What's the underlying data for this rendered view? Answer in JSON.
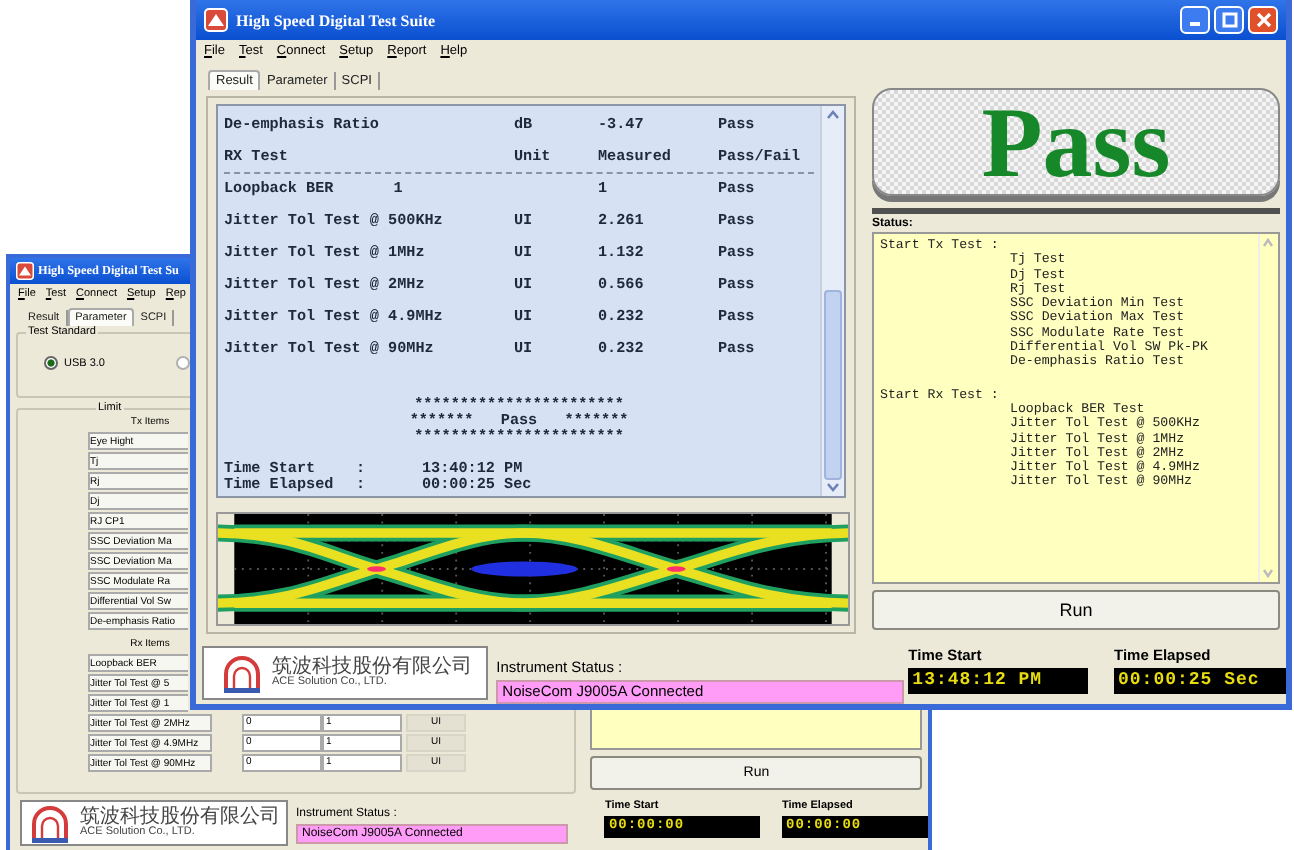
{
  "parameter_window": {
    "title": "High Speed Digital Test Su",
    "menu": [
      "File",
      "Test",
      "Connect",
      "Setup",
      "Rep"
    ],
    "tabs": [
      {
        "label": "Result",
        "selected": false
      },
      {
        "label": "Parameter",
        "selected": true
      },
      {
        "label": "SCPI",
        "selected": false
      }
    ],
    "test_standard": {
      "title": "Test Standard",
      "options": [
        {
          "label": "USB 3.0",
          "selected": true
        },
        {
          "selected": false
        }
      ]
    },
    "limit": {
      "title": "Limit",
      "tx_header": "Tx Items",
      "tx_items": [
        "Eye Hight",
        "Tj",
        "Rj",
        "Dj",
        "RJ CP1",
        "SSC Deviation Ma",
        "SSC Deviation Ma",
        "SSC Modulate Ra",
        "Differential Vol Sw",
        "De-emphasis Ratio"
      ],
      "rx_header": "Rx Items",
      "rx_items": [
        {
          "name": "Loopback BER"
        },
        {
          "name": "Jitter Tol Test @ 5"
        },
        {
          "name": "Jitter Tol Test @ 1"
        },
        {
          "name": "Jitter Tol Test @ 2MHz",
          "min": "0",
          "max": "1",
          "unit": "UI"
        },
        {
          "name": "Jitter Tol Test @ 4.9MHz",
          "min": "0",
          "max": "1",
          "unit": "UI"
        },
        {
          "name": "Jitter Tol Test @ 90MHz",
          "min": "0",
          "max": "1",
          "unit": "UI"
        }
      ]
    },
    "run_button": "Run",
    "company": {
      "name_zh": "筑波科技股份有限公司",
      "name_en": "ACE Solution Co., LTD."
    },
    "instrument_status": {
      "label": "Instrument Status :",
      "value": "NoiseCom J9005A Connected"
    },
    "time_start": {
      "label": "Time Start",
      "value": "00:00:00"
    },
    "time_elapsed": {
      "label": "Time Elapsed",
      "value": "00:00:00"
    }
  },
  "result_window": {
    "title": "High Speed Digital Test Suite",
    "menu": [
      "File",
      "Test",
      "Connect",
      "Setup",
      "Report",
      "Help"
    ],
    "tabs": [
      {
        "label": "Result",
        "selected": true
      },
      {
        "label": "Parameter",
        "selected": false
      },
      {
        "label": "SCPI",
        "selected": false
      }
    ],
    "results": {
      "rows": [
        {
          "kind": "row",
          "test": "De-emphasis Ratio",
          "unit": "dB",
          "measured": "-3.47",
          "result": "Pass"
        },
        {
          "kind": "header",
          "test": "RX Test",
          "unit": "Unit",
          "measured": "Measured",
          "result": "Pass/Fail"
        },
        {
          "kind": "row",
          "test": "Loopback BER",
          "spec": "1",
          "measured": "1",
          "result": "Pass"
        },
        {
          "kind": "row",
          "test": "Jitter Tol Test @ 500KHz",
          "unit": "UI",
          "measured": "2.261",
          "result": "Pass"
        },
        {
          "kind": "row",
          "test": "Jitter Tol Test @ 1MHz",
          "unit": "UI",
          "measured": "1.132",
          "result": "Pass"
        },
        {
          "kind": "row",
          "test": "Jitter Tol Test @ 2MHz",
          "unit": "UI",
          "measured": "0.566",
          "result": "Pass"
        },
        {
          "kind": "row",
          "test": "Jitter Tol Test @ 4.9MHz",
          "unit": "UI",
          "measured": "0.232",
          "result": "Pass"
        },
        {
          "kind": "row",
          "test": "Jitter Tol Test @ 90MHz",
          "unit": "UI",
          "measured": "0.232",
          "result": "Pass"
        }
      ],
      "banner": [
        "***********************",
        "*******   Pass   *******",
        "***********************"
      ],
      "times": [
        {
          "label": "Time Start",
          "sep": ":",
          "value": "13:40:12 PM"
        },
        {
          "label": "Time Elapsed",
          "sep": ":",
          "value": "00:00:25 Sec"
        }
      ]
    },
    "verdict": "Pass",
    "status": {
      "label": "Status:",
      "groups": [
        {
          "heading": "Start Tx Test :",
          "items": [
            "Tj Test",
            "Dj Test",
            "Rj Test",
            "SSC Deviation Min Test",
            "SSC Deviation Max Test",
            "SSC Modulate Rate Test",
            "Differential Vol SW Pk-PK",
            "De-emphasis Ratio Test"
          ]
        },
        {
          "heading": "Start Rx Test :",
          "items": [
            "Loopback BER Test",
            "Jitter Tol Test @ 500KHz",
            "Jitter Tol Test @ 1MHz",
            "Jitter Tol Test @ 2MHz",
            "Jitter Tol Test @ 4.9MHz",
            "Jitter Tol Test @ 90MHz"
          ]
        }
      ]
    },
    "run_button": "Run",
    "company": {
      "name_zh": "筑波科技股份有限公司",
      "name_en": "ACE Solution Co., LTD."
    },
    "instrument_status": {
      "label": "Instrument Status :",
      "value": "NoiseCom J9005A Connected"
    },
    "time_start": {
      "label": "Time Start",
      "value": "13:48:12 PM"
    },
    "time_elapsed": {
      "label": "Time Elapsed",
      "value": "00:00:25 Sec"
    }
  }
}
